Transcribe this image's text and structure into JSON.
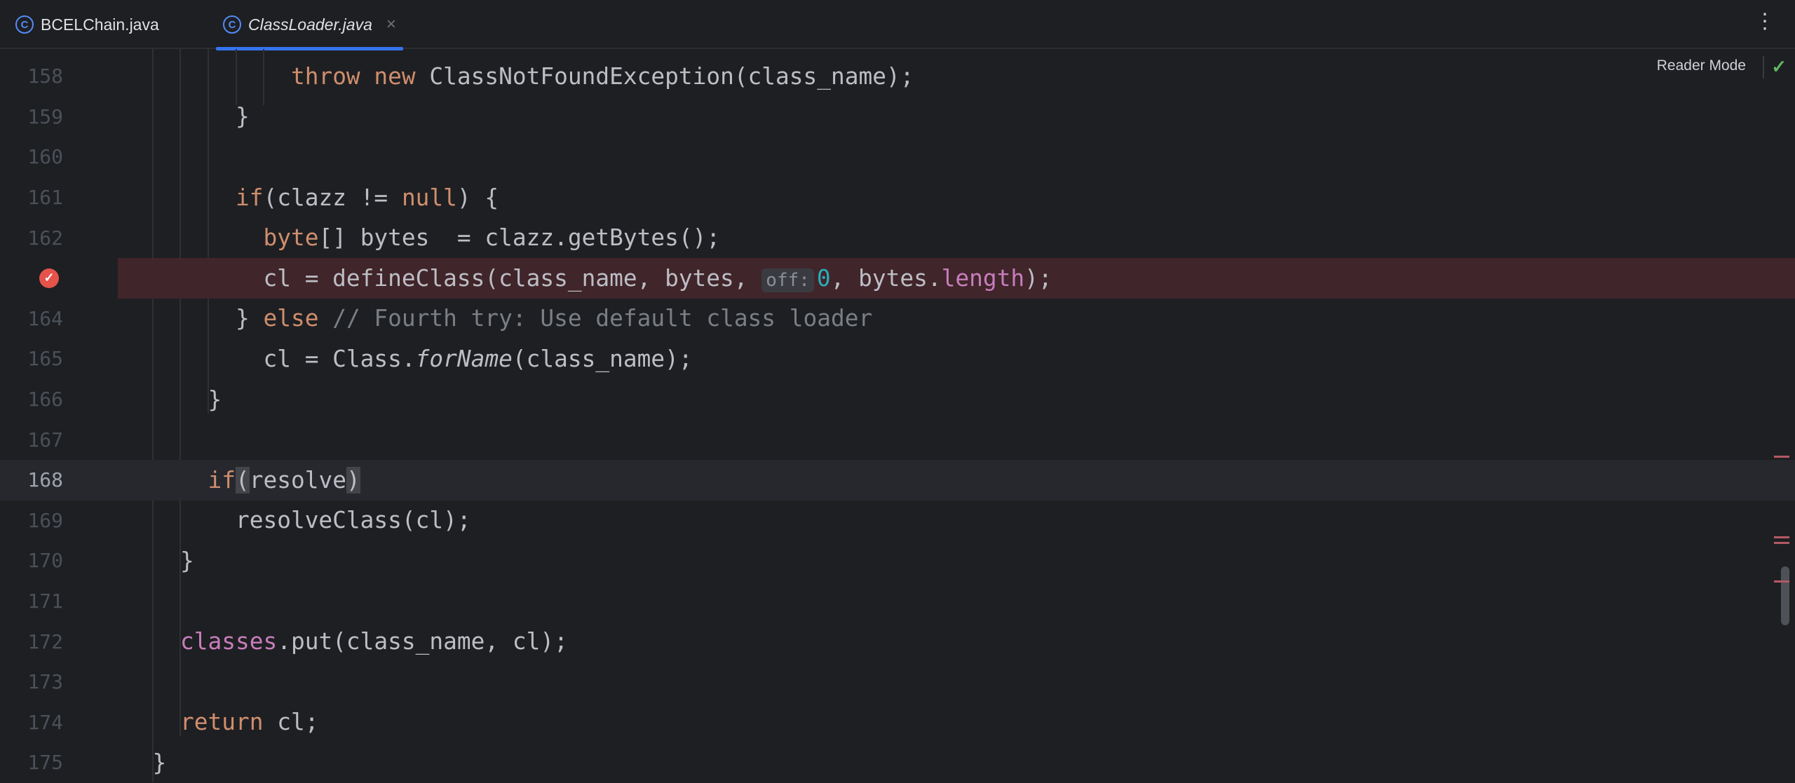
{
  "tabs": [
    {
      "label": "BCELChain.java",
      "icon": "class-icon",
      "active": false
    },
    {
      "label": "ClassLoader.java",
      "icon": "class-icon",
      "active": true,
      "close": "×"
    }
  ],
  "toolbar": {
    "more": "⋮",
    "reader_mode": "Reader Mode",
    "check": "✓"
  },
  "colors": {
    "keyword": "#cf8e6d",
    "field": "#c77dbb",
    "number": "#2aacb8",
    "comment": "#7a7e85",
    "breakpoint_line": "#40252b",
    "accent": "#3574f0"
  },
  "lines": [
    {
      "n": "158",
      "t": "            throw new ClassNotFoundException(class_name);"
    },
    {
      "n": "159",
      "t": "        }"
    },
    {
      "n": "160",
      "t": ""
    },
    {
      "n": "161",
      "t": "        if(clazz != null) {"
    },
    {
      "n": "162",
      "t": "          byte[] bytes  = clazz.getBytes();"
    },
    {
      "n": "163",
      "t": "          cl = defineClass(class_name, bytes, off: 0, bytes.length);",
      "breakpoint": true
    },
    {
      "n": "164",
      "t": "        } else // Fourth try: Use default class loader"
    },
    {
      "n": "165",
      "t": "          cl = Class.forName(class_name);"
    },
    {
      "n": "166",
      "t": "      }"
    },
    {
      "n": "167",
      "t": ""
    },
    {
      "n": "168",
      "t": "      if(resolve)",
      "current": true
    },
    {
      "n": "169",
      "t": "        resolveClass(cl);"
    },
    {
      "n": "170",
      "t": "    }"
    },
    {
      "n": "171",
      "t": ""
    },
    {
      "n": "172",
      "t": "    classes.put(class_name, cl);"
    },
    {
      "n": "173",
      "t": ""
    },
    {
      "n": "174",
      "t": "    return cl;"
    },
    {
      "n": "175",
      "t": "  }"
    }
  ],
  "tokens": {
    "l158": {
      "a": "            ",
      "kw": "throw new",
      "b": " ClassNotFoundException(class_name);"
    },
    "l159": "        }",
    "l161": {
      "a": "        ",
      "kw": "if",
      "b": "(clazz != ",
      "kw2": "null",
      "c": ") {"
    },
    "l162": {
      "a": "          ",
      "kw": "byte",
      "b": "[] bytes  = clazz.getBytes();"
    },
    "l163": {
      "a": "          cl = defineClass(class_name, bytes, ",
      "hint": "off:",
      "num": "0",
      "b": ", bytes.",
      "fld": "length",
      "c": ");"
    },
    "l164": {
      "a": "        } ",
      "kw": "else",
      "cm": " // Fourth try: Use default class loader"
    },
    "l165": {
      "a": "          cl = Class.",
      "it": "forName",
      "b": "(class_name);"
    },
    "l166": "      }",
    "l168": {
      "a": "      ",
      "kw": "if",
      "p1": "(",
      "b": "resolve",
      "p2": ")"
    },
    "l169": "        resolveClass(cl);",
    "l170": "    }",
    "l172": {
      "a": "    ",
      "fld": "classes",
      "b": ".put(class_name, cl);"
    },
    "l174": {
      "a": "    ",
      "kw": "return",
      "b": " cl;"
    },
    "l175": "  }"
  }
}
